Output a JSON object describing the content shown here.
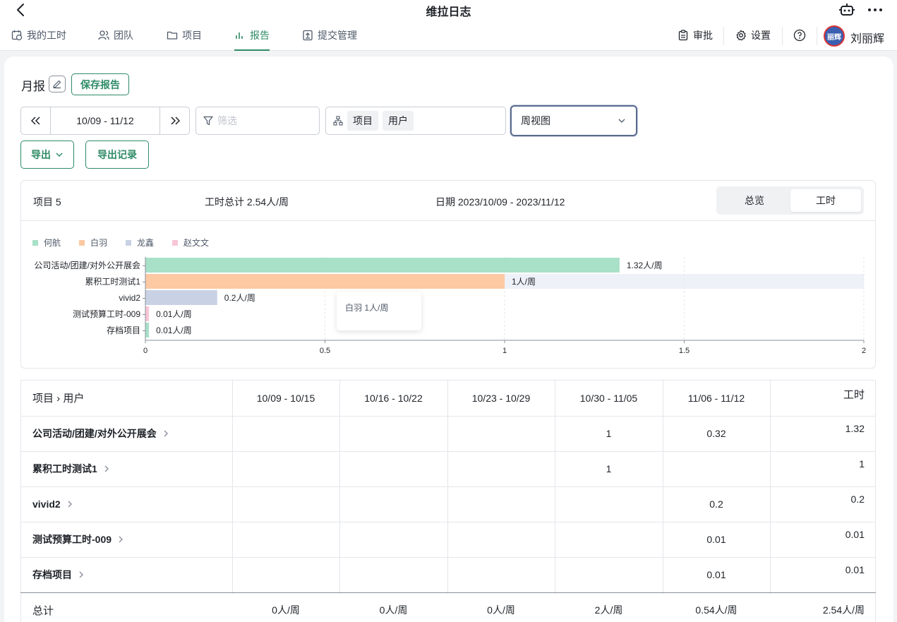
{
  "app": {
    "title": "维拉日志",
    "back_icon": "chevron-left-icon",
    "robot_icon": "robot-icon",
    "more_icon": "more-horizontal-icon"
  },
  "nav": {
    "items": [
      {
        "label": "我的工时",
        "icon": "calendar-clock-icon"
      },
      {
        "label": "团队",
        "icon": "users-icon"
      },
      {
        "label": "项目",
        "icon": "folder-icon"
      },
      {
        "label": "报告",
        "icon": "bar-chart-icon",
        "active": true
      },
      {
        "label": "提交管理",
        "icon": "upload-box-icon"
      }
    ],
    "approve_label": "审批",
    "settings_label": "设置",
    "help_icon": "help-circle-icon",
    "avatar_text": "丽辉",
    "user_name": "刘丽辉"
  },
  "colors": {
    "accent": "#2e8b66",
    "series": [
      "#a8e0c8",
      "#fcc9a3",
      "#c8d2e4",
      "#f9c6d6"
    ],
    "highlight_row": "#eef1f8"
  },
  "report": {
    "title": "月报",
    "save_label": "保存报告",
    "date_range": "10/09 - 11/12",
    "filter_placeholder": "筛选",
    "group_chips": [
      "项目",
      "用户"
    ],
    "view_select": "周视图",
    "export_label": "导出",
    "export_log_label": "导出记录"
  },
  "summary": {
    "project_count": "项目 5",
    "total_hours": "工时总计 2.54人/周",
    "date_label": "日期 2023/10/09 - 2023/11/12",
    "tabs": [
      "总览",
      "工时"
    ],
    "active_tab": 1
  },
  "chart_data": {
    "type": "bar",
    "orientation": "horizontal",
    "stacked": true,
    "legend": [
      "何航",
      "白羽",
      "龙鑫",
      "赵文文"
    ],
    "legend_position": "top-left",
    "categories": [
      "公司活动/团建/对外公开展会",
      "累积工时测试1",
      "vivid2",
      "测试预算工时-009",
      "存档项目"
    ],
    "series": [
      {
        "name": "何航",
        "values": [
          1.32,
          0,
          0,
          0,
          0.01
        ]
      },
      {
        "name": "白羽",
        "values": [
          0,
          1,
          0,
          0,
          0
        ]
      },
      {
        "name": "龙鑫",
        "values": [
          0,
          0,
          0.2,
          0,
          0
        ]
      },
      {
        "name": "赵文文",
        "values": [
          0,
          0,
          0,
          0.01,
          0
        ]
      }
    ],
    "bar_labels": [
      "1.32人/周",
      "1人/周",
      "0.2人/周",
      "0.01人/周",
      "0.01人/周"
    ],
    "x_ticks": [
      "0",
      "0.5",
      "1",
      "1.5",
      "2"
    ],
    "xlim": [
      0,
      2
    ],
    "grid": "vertical dashed",
    "highlighted_category": "累积工时测试1",
    "tooltip": "白羽 1人/周"
  },
  "table": {
    "header_first": "项目 › 用户",
    "columns": [
      "10/09 - 10/15",
      "10/16 - 10/22",
      "10/23 - 10/29",
      "10/30 - 11/05",
      "11/06 - 11/12",
      "工时"
    ],
    "rows": [
      {
        "label": "公司活动/团建/对外公开展会",
        "cells": [
          "",
          "",
          "",
          "1",
          "0.32",
          "1.32"
        ]
      },
      {
        "label": "累积工时测试1",
        "cells": [
          "",
          "",
          "",
          "1",
          "",
          "1"
        ]
      },
      {
        "label": "vivid2",
        "cells": [
          "",
          "",
          "",
          "",
          "0.2",
          "0.2"
        ]
      },
      {
        "label": "测试预算工时-009",
        "cells": [
          "",
          "",
          "",
          "",
          "0.01",
          "0.01"
        ]
      },
      {
        "label": "存档项目",
        "cells": [
          "",
          "",
          "",
          "",
          "0.01",
          "0.01"
        ]
      }
    ],
    "total_label": "总计",
    "totals": [
      "0人/周",
      "0人/周",
      "0人/周",
      "2人/周",
      "0.54人/周",
      "2.54人/周"
    ]
  }
}
